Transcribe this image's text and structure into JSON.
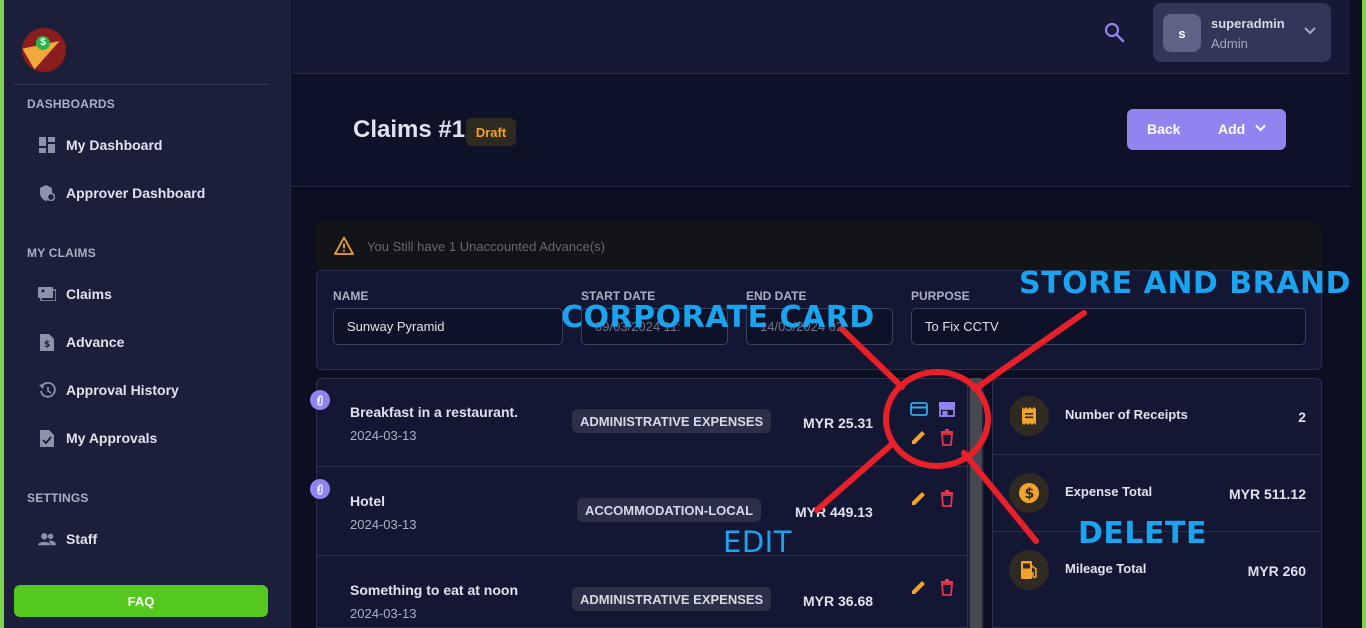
{
  "sidebar": {
    "sections": [
      {
        "label": "DASHBOARDS"
      },
      {
        "label": "MY CLAIMS"
      },
      {
        "label": "SETTINGS"
      }
    ],
    "items": [
      {
        "label": "My Dashboard",
        "icon": "dashboard-icon"
      },
      {
        "label": "Approver Dashboard",
        "icon": "shield-gear-icon"
      },
      {
        "label": "Claims",
        "icon": "image-icon"
      },
      {
        "label": "Advance",
        "icon": "dollar-doc-icon"
      },
      {
        "label": "Approval History",
        "icon": "history-icon"
      },
      {
        "label": "My Approvals",
        "icon": "check-doc-icon"
      },
      {
        "label": "Staff",
        "icon": "people-icon"
      }
    ],
    "faq_label": "FAQ"
  },
  "topbar": {
    "user": {
      "initial": "s",
      "name": "superadmin",
      "role": "Admin"
    }
  },
  "header": {
    "title": "Claims #1",
    "status": "Draft",
    "back_label": "Back",
    "add_label": "Add"
  },
  "alert": {
    "text": "You Still have 1 Unaccounted Advance(s)"
  },
  "form": {
    "name_label": "NAME",
    "name_value": "Sunway Pyramid",
    "start_label": "START DATE",
    "start_value": "09/03/2024 11:",
    "end_label": "END DATE",
    "end_value": "14/03/2024 02:",
    "purpose_label": "PURPOSE",
    "purpose_value": "To Fix CCTV"
  },
  "expenses": [
    {
      "title": "Breakfast in a restaurant.",
      "date": "2024-03-13",
      "category": "ADMINISTRATIVE EXPENSES",
      "amount": "MYR 25.31"
    },
    {
      "title": "Hotel",
      "date": "2024-03-13",
      "category": "ACCOMMODATION-LOCAL",
      "amount": "MYR 449.13"
    },
    {
      "title": "Something to eat at noon",
      "date": "2024-03-13",
      "category": "ADMINISTRATIVE EXPENSES",
      "amount": "MYR 36.68"
    }
  ],
  "summary": [
    {
      "label": "Number of Receipts",
      "value": "2",
      "icon": "receipt-icon"
    },
    {
      "label": "Expense Total",
      "value": "MYR 511.12",
      "icon": "dollar-icon"
    },
    {
      "label": "Mileage Total",
      "value": "MYR 260",
      "icon": "fuel-icon"
    }
  ],
  "annotations": {
    "corporate_card": "CORPORATE CARD",
    "store_brand": "STORE AND BRAND",
    "edit": "EDIT",
    "delete": "DELETE"
  },
  "colors": {
    "accent": "#8f84f0",
    "faq": "#54c81f",
    "draft": "#f2a32b",
    "annotation_text": "#1aa3ee",
    "annotation_stroke": "#e8202a",
    "edit_icon": "#f2a32b",
    "delete_icon": "#e5364d",
    "card_icon": "#2fa9f0",
    "store_icon": "#8f84f0"
  }
}
